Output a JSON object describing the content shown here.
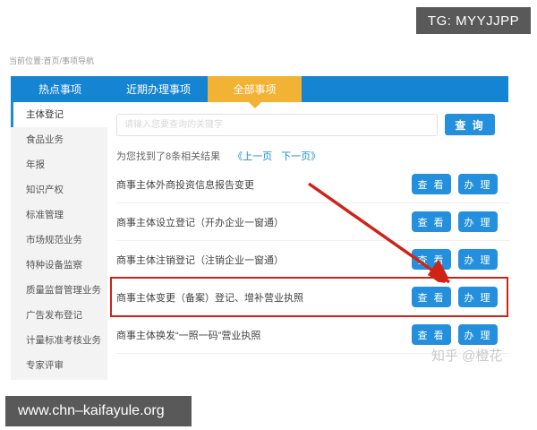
{
  "badges": {
    "tg": "TG: MYYJJPP",
    "site": "www.chn–kaifayule.org"
  },
  "watermark": "知乎 @橙花",
  "breadcrumb": "当前位置:首页/事项导航",
  "tabs": {
    "hot": "热点事项",
    "recent": "近期办理事项",
    "all": "全部事项"
  },
  "sidebar": {
    "items": [
      {
        "label": "主体登记",
        "active": true
      },
      {
        "label": "食品业务",
        "active": false
      },
      {
        "label": "年报",
        "active": false
      },
      {
        "label": "知识产权",
        "active": false
      },
      {
        "label": "标准管理",
        "active": false
      },
      {
        "label": "市场规范业务",
        "active": false
      },
      {
        "label": "特种设备监察",
        "active": false
      },
      {
        "label": "质量监督管理业务",
        "active": false
      },
      {
        "label": "广告发布登记",
        "active": false
      },
      {
        "label": "计量标准考核业务",
        "active": false
      },
      {
        "label": "专家评审",
        "active": false
      }
    ]
  },
  "search": {
    "placeholder": "请输入您要查询的关键字",
    "button_label": "查 询"
  },
  "results": {
    "summary": "为您找到了8条相关结果",
    "prev_label": "《上一页",
    "next_label": "下一页》"
  },
  "list": {
    "view_label": "查 看",
    "handle_label": "办 理",
    "items": [
      {
        "title": "商事主体外商投资信息报告变更",
        "highlighted": false
      },
      {
        "title": "商事主体设立登记（开办企业一窗通）",
        "highlighted": false
      },
      {
        "title": "商事主体注销登记（注销企业一窗通）",
        "highlighted": false
      },
      {
        "title": "商事主体变更（备案）登记、增补营业执照",
        "highlighted": true
      },
      {
        "title": "商事主体换发“一照一码”营业执照",
        "highlighted": false
      }
    ]
  },
  "colors": {
    "primary_blue": "#1584d3",
    "button_blue": "#2490dd",
    "accent_orange": "#f2b233",
    "highlight_red": "#cc2418",
    "badge_gray": "#595959"
  }
}
